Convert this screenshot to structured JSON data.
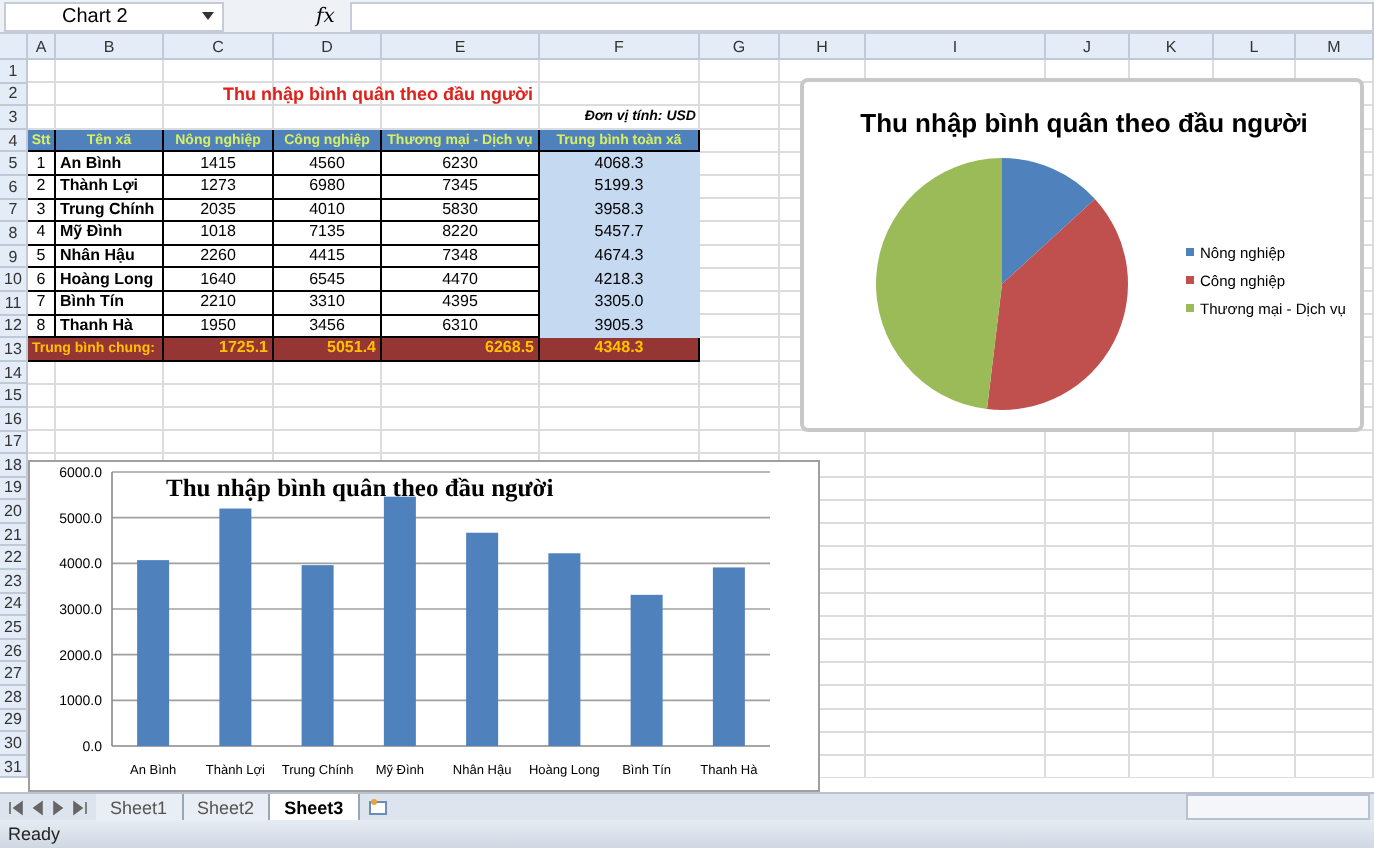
{
  "formula_bar": {
    "name_box": "Chart 2",
    "function_label": "fx"
  },
  "columns": [
    "A",
    "B",
    "C",
    "D",
    "E",
    "F",
    "G",
    "H",
    "I",
    "J",
    "K",
    "L",
    "M"
  ],
  "row_headers": [
    "1",
    "2",
    "3",
    "4",
    "5",
    "6",
    "7",
    "8",
    "9",
    "10",
    "11",
    "12",
    "13",
    "14",
    "15",
    "16",
    "17",
    "18",
    "19",
    "20",
    "21",
    "22",
    "23",
    "24",
    "25",
    "26",
    "27",
    "28",
    "29",
    "30",
    "31"
  ],
  "table": {
    "title": "Thu nhập bình quân theo đầu người",
    "unit": "Đơn vị tính: USD",
    "columns": [
      "Stt",
      "Tên xã",
      "Nông nghiệp",
      "Công nghiệp",
      "Thương mại - Dịch vụ",
      "Trung bình toàn xã"
    ],
    "rows": [
      {
        "cells": [
          "1",
          "An Bình",
          "1415",
          "4560",
          "6230",
          "4068.3"
        ]
      },
      {
        "cells": [
          "2",
          "Thành Lợi",
          "1273",
          "6980",
          "7345",
          "5199.3"
        ]
      },
      {
        "cells": [
          "3",
          "Trung Chính",
          "2035",
          "4010",
          "5830",
          "3958.3"
        ]
      },
      {
        "cells": [
          "4",
          "Mỹ Đình",
          "1018",
          "7135",
          "8220",
          "5457.7"
        ]
      },
      {
        "cells": [
          "5",
          "Nhân Hậu",
          "2260",
          "4415",
          "7348",
          "4674.3"
        ]
      },
      {
        "cells": [
          "6",
          "Hoàng Long",
          "1640",
          "6545",
          "4470",
          "4218.3"
        ]
      },
      {
        "cells": [
          "7",
          "Bình Tín",
          "2210",
          "3310",
          "4395",
          "3305.0"
        ]
      },
      {
        "cells": [
          "8",
          "Thanh Hà",
          "1950",
          "3456",
          "6310",
          "3905.3"
        ]
      }
    ],
    "total": {
      "label": "Trung bình chung:",
      "cells": [
        "1725.1",
        "5051.4",
        "6268.5",
        "4348.3"
      ]
    }
  },
  "pie_chart": {
    "chart_data": {
      "type": "pie",
      "title": "Thu nhập bình quân theo đầu người",
      "categories": [
        "Nông nghiệp",
        "Công nghiệp",
        "Thương mại - Dịch vụ"
      ],
      "colors": [
        "#4f81bd",
        "#c0504d",
        "#9bbb59"
      ],
      "legend": true,
      "series": [
        {
          "values": [
            13.2,
            38.7,
            48.1
          ]
        }
      ]
    }
  },
  "bar_chart": {
    "chart_data": {
      "type": "bar",
      "title": "Thu nhập bình quân theo đầu người",
      "categories": [
        "An Bình",
        "Thành Lợi",
        "Trung Chính",
        "Mỹ Đình",
        "Nhân Hậu",
        "Hoàng Long",
        "Bình Tín",
        "Thanh Hà"
      ],
      "series": [
        {
          "color": "#4f81bd",
          "values": [
            4070,
            5200,
            3960,
            5460,
            4670,
            4220,
            3310,
            3910
          ]
        }
      ],
      "grid": true,
      "ylim": [
        0,
        6000
      ],
      "yticks": [
        {
          "value": 0,
          "label": "0.0"
        },
        {
          "value": 1000,
          "label": "1000.0"
        },
        {
          "value": 2000,
          "label": "2000.0"
        },
        {
          "value": 3000,
          "label": "3000.0"
        },
        {
          "value": 4000,
          "label": "4000.0"
        },
        {
          "value": 5000,
          "label": "5000.0"
        },
        {
          "value": 6000,
          "label": "6000.0"
        }
      ]
    }
  },
  "sheet_tabs": [
    {
      "label": "Sheet1",
      "selected": false
    },
    {
      "label": "Sheet2",
      "selected": false
    },
    {
      "label": "Sheet3",
      "selected": true
    }
  ],
  "status_bar": {
    "text": "Ready"
  }
}
